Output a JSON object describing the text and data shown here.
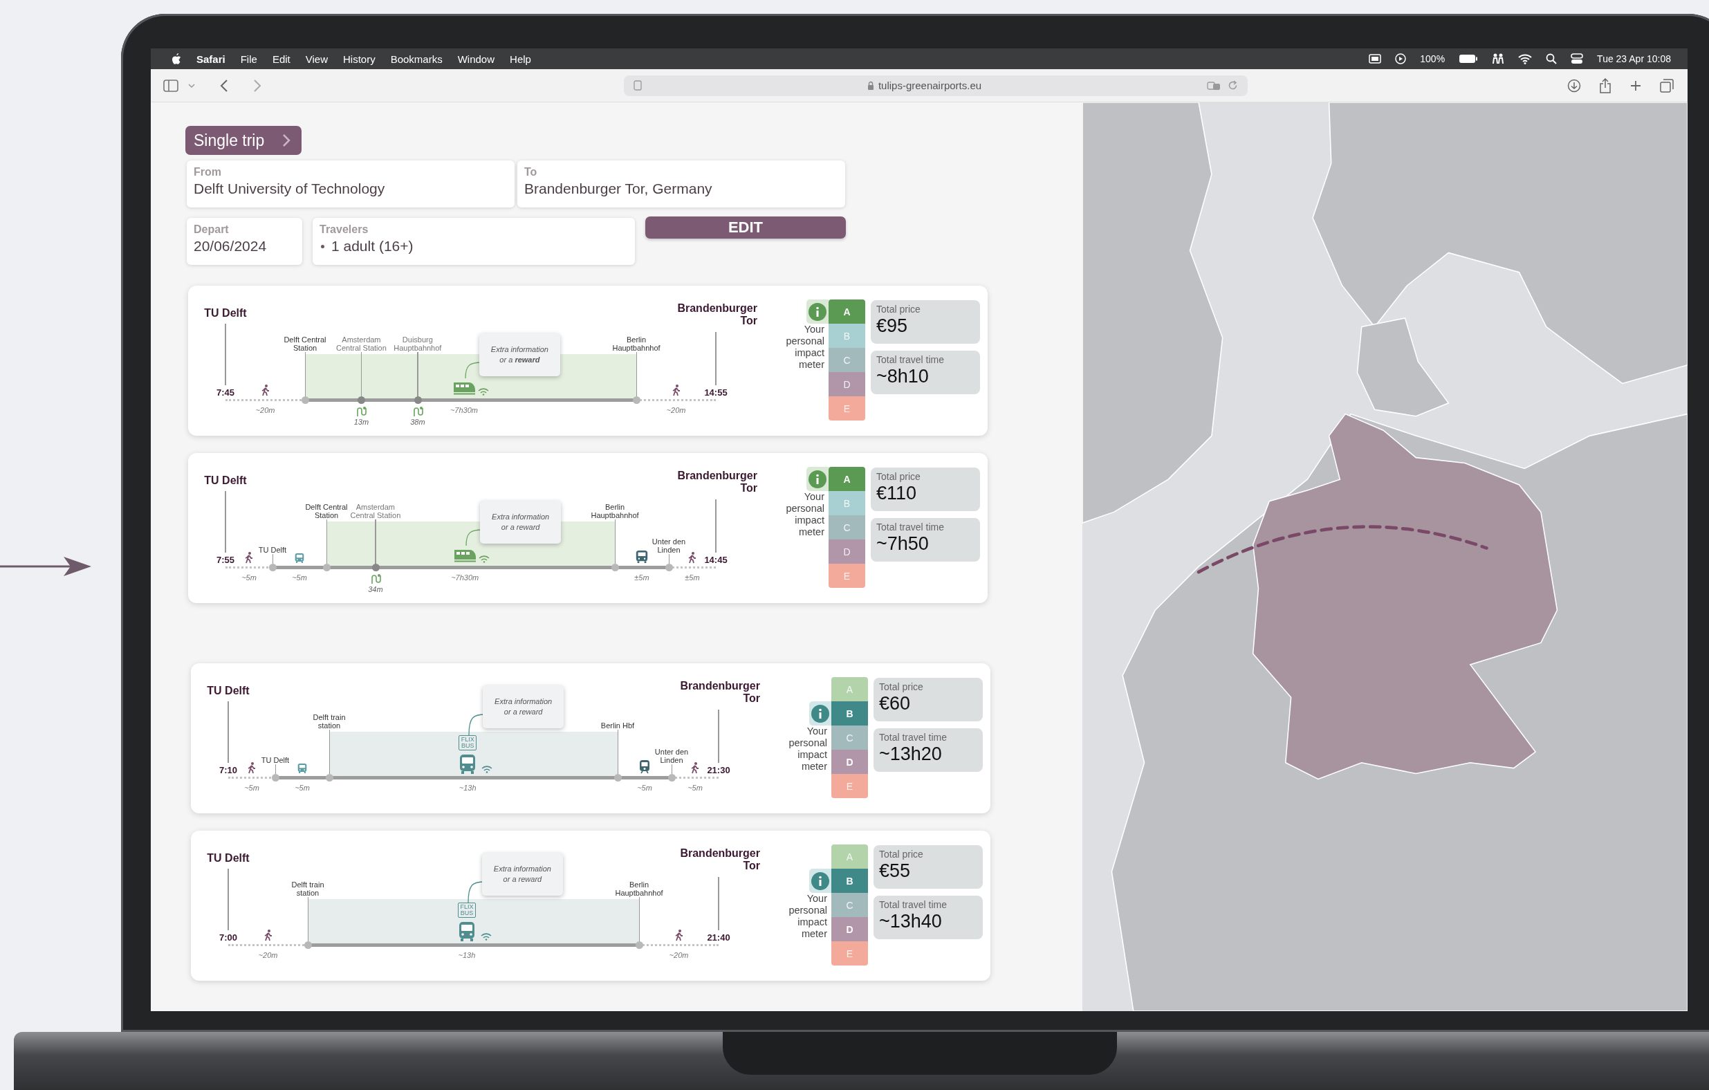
{
  "menu_bar": {
    "app": "Safari",
    "items": [
      "File",
      "Edit",
      "View",
      "History",
      "Bookmarks",
      "Window",
      "Help"
    ],
    "battery": "100%",
    "clock": "Tue 23 Apr  10:08"
  },
  "browser": {
    "url": "tulips-greenairports.eu"
  },
  "trip_type": {
    "label": "Single trip"
  },
  "fields": [
    {
      "label": "From",
      "value": "Delft University of Technology"
    },
    {
      "label": "To",
      "value": "Brandenburger Tor, Germany"
    }
  ],
  "depart": {
    "label": "Depart",
    "value": "20/06/2024"
  },
  "travelers": {
    "label": "Travelers",
    "items": [
      "1 adult (16+)"
    ]
  },
  "edit_button": "EDIT",
  "trip_groups": [
    [
      {
        "origin": "TU Delft",
        "depart_time": "7:45",
        "destination": "Brandenburger Tor",
        "arrive_time": "14:55",
        "legs": [
          {
            "kind": "walk",
            "duration": "~20m",
            "to": "Delft Central Station"
          },
          {
            "kind": "train",
            "duration": "~7h30m",
            "to": "Berlin Hauptbahnhof",
            "wifi": true,
            "note": "Extra information or a **reward**",
            "stops": [
              {
                "name": "Amsterdam Central Station",
                "transfer": "13m"
              },
              {
                "name": "Duisburg Hauptbahnhof",
                "transfer": "38m"
              }
            ]
          },
          {
            "kind": "walk",
            "duration": "~20m"
          }
        ],
        "impact": {
          "caption": "Your personal impact meter",
          "grades": [
            {
              "grade": "A",
              "selected": true,
              "highlighted": false
            },
            {
              "grade": "B",
              "selected": false,
              "highlighted": false
            },
            {
              "grade": "C",
              "selected": false,
              "highlighted": false
            },
            {
              "grade": "D",
              "selected": false,
              "highlighted": false
            },
            {
              "grade": "E",
              "selected": false,
              "highlighted": false
            }
          ]
        },
        "price": {
          "label": "Total price",
          "value": "€95"
        },
        "travel_time": {
          "label": "Total travel time",
          "value": "~8h10"
        }
      },
      {
        "origin": "TU Delft",
        "depart_time": "7:55",
        "destination": "Brandenburger Tor",
        "arrive_time": "14:45",
        "legs": [
          {
            "kind": "walk",
            "duration": "~5m",
            "to": "TU Delft"
          },
          {
            "kind": "bus",
            "duration": "~5m",
            "to": "Delft Central Station"
          },
          {
            "kind": "train",
            "duration": "~7h30m",
            "to": "Berlin Hauptbahnhof",
            "wifi": true,
            "note": "Extra information or a reward",
            "stops": [
              {
                "name": "Amsterdam Central Station",
                "transfer": "34m"
              }
            ]
          },
          {
            "kind": "bus",
            "duration": "±5m",
            "to": "Unter den Linden"
          },
          {
            "kind": "walk",
            "duration": "±5m"
          }
        ],
        "impact": {
          "caption": "Your personal impact meter",
          "grades": [
            {
              "grade": "A",
              "selected": true,
              "highlighted": false
            },
            {
              "grade": "B",
              "selected": false,
              "highlighted": false
            },
            {
              "grade": "C",
              "selected": false,
              "highlighted": false
            },
            {
              "grade": "D",
              "selected": false,
              "highlighted": false
            },
            {
              "grade": "E",
              "selected": false,
              "highlighted": false
            }
          ]
        },
        "price": {
          "label": "Total price",
          "value": "€110"
        },
        "travel_time": {
          "label": "Total travel time",
          "value": "~7h50"
        }
      }
    ],
    [
      {
        "origin": "TU Delft",
        "depart_time": "7:10",
        "destination": "Brandenburger Tor",
        "arrive_time": "21:30",
        "legs": [
          {
            "kind": "walk",
            "duration": "~5m",
            "to": "TU Delft"
          },
          {
            "kind": "bus",
            "duration": "~5m",
            "to": "Delft train station"
          },
          {
            "kind": "coach",
            "duration": "~13h",
            "to": "Berlin Hbf",
            "wifi": true,
            "operator": "FLIX BUS",
            "note": "Extra information or a reward"
          },
          {
            "kind": "tram",
            "duration": "~5m",
            "to": "Unter den Linden"
          },
          {
            "kind": "walk",
            "duration": "~5m"
          }
        ],
        "impact": {
          "caption": "Your personal impact meter",
          "grades": [
            {
              "grade": "A",
              "selected": false,
              "highlighted": false
            },
            {
              "grade": "B",
              "selected": true,
              "highlighted": false
            },
            {
              "grade": "C",
              "selected": false,
              "highlighted": false
            },
            {
              "grade": "D",
              "selected": false,
              "highlighted": true
            },
            {
              "grade": "E",
              "selected": false,
              "highlighted": false
            }
          ]
        },
        "price": {
          "label": "Total price",
          "value": "€60"
        },
        "travel_time": {
          "label": "Total travel time",
          "value": "~13h20"
        }
      },
      {
        "origin": "TU Delft",
        "depart_time": "7:00",
        "destination": "Brandenburger Tor",
        "arrive_time": "21:40",
        "legs": [
          {
            "kind": "walk",
            "duration": "~20m",
            "to": "Delft train station"
          },
          {
            "kind": "coach",
            "duration": "~13h",
            "to": "Berlin Hauptbahnhof",
            "wifi": true,
            "operator": "FLIX BUS",
            "note": "Extra information or a reward"
          },
          {
            "kind": "walk",
            "duration": "~20m"
          }
        ],
        "impact": {
          "caption": "Your personal impact meter",
          "grades": [
            {
              "grade": "A",
              "selected": false,
              "highlighted": false
            },
            {
              "grade": "B",
              "selected": true,
              "highlighted": false
            },
            {
              "grade": "C",
              "selected": false,
              "highlighted": false
            },
            {
              "grade": "D",
              "selected": false,
              "highlighted": true
            },
            {
              "grade": "E",
              "selected": false,
              "highlighted": false
            }
          ]
        },
        "price": {
          "label": "Total price",
          "value": "€55"
        },
        "travel_time": {
          "label": "Total travel time",
          "value": "~13h40"
        }
      }
    ]
  ]
}
